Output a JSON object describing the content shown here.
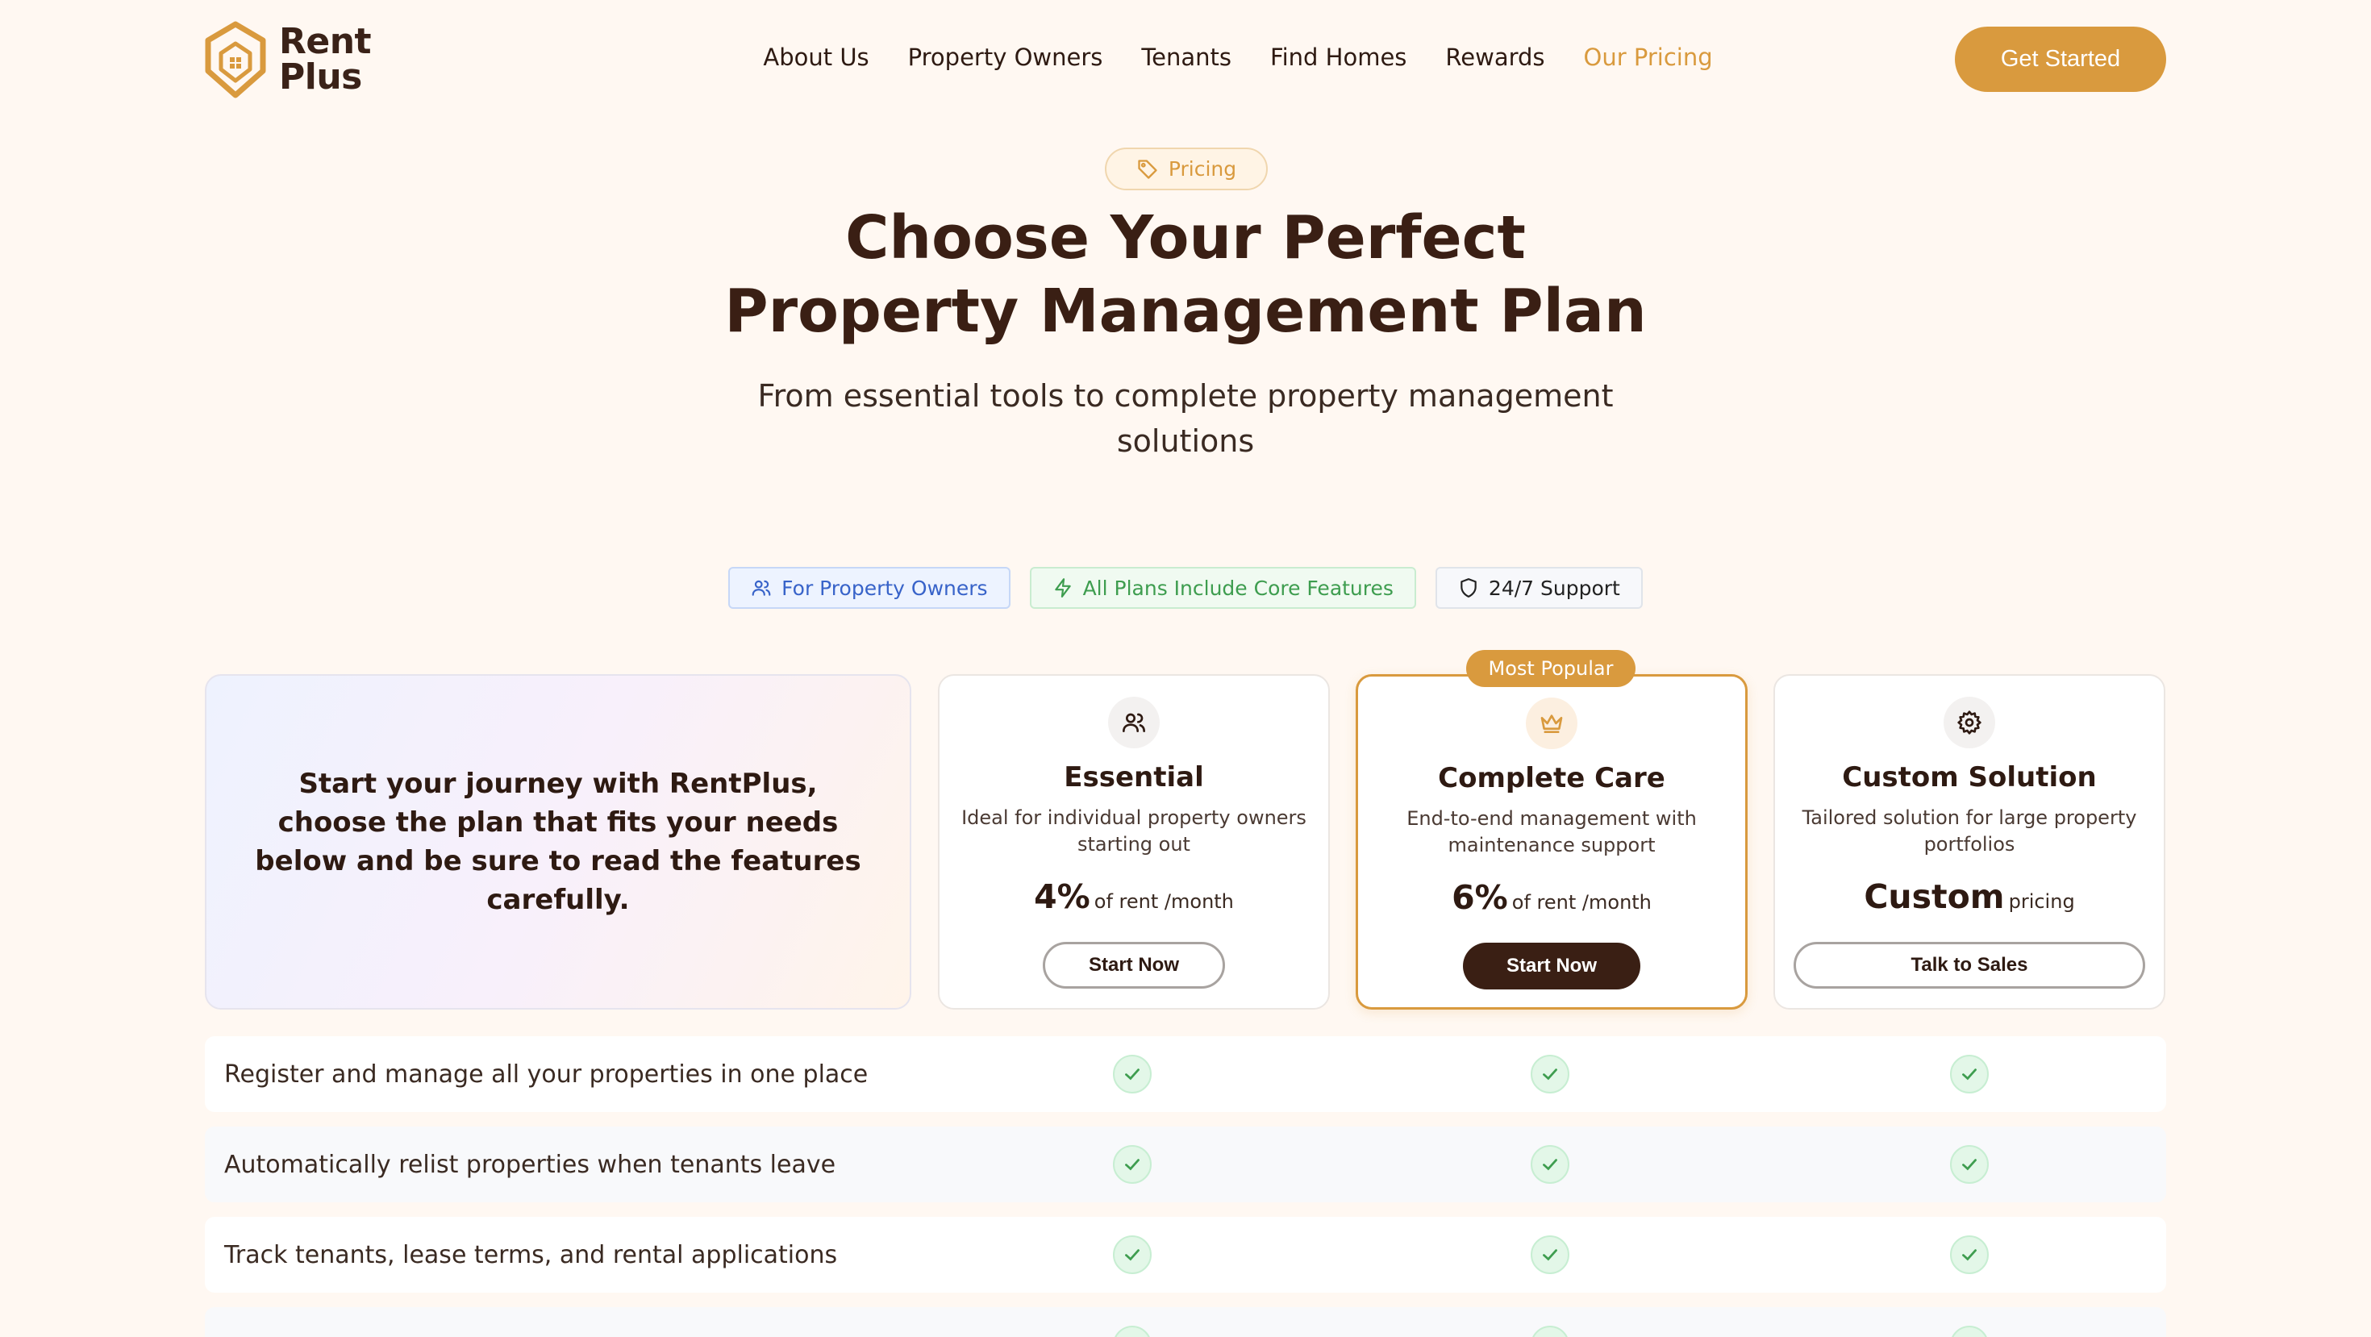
{
  "brand": {
    "line1": "Rent",
    "line2": "Plus",
    "accent": "#d99a3e"
  },
  "nav": {
    "links": [
      "About Us",
      "Property Owners",
      "Tenants",
      "Find Homes",
      "Rewards",
      "Our Pricing"
    ],
    "active_index": 5,
    "cta": "Get Started"
  },
  "hero": {
    "pill": "Pricing",
    "title_line1": "Choose Your Perfect",
    "title_line2": "Property Management Plan",
    "subtitle": "From essential tools to complete property management solutions"
  },
  "badges": [
    {
      "label": "For Property Owners",
      "icon": "users-icon",
      "style": "blue"
    },
    {
      "label": "All Plans Include Core Features",
      "icon": "lightning-icon",
      "style": "green"
    },
    {
      "label": "24/7 Support",
      "icon": "shield-icon",
      "style": "gray"
    }
  ],
  "intro": "Start your journey with RentPlus, choose the plan that fits your needs below and be sure to read the features carefully.",
  "popular_label": "Most Popular",
  "plans": [
    {
      "name": "Essential",
      "icon": "users-icon",
      "description": "Ideal for individual property owners starting out",
      "price": "4%",
      "unit": "of rent /month",
      "button": "Start Now",
      "button_style": "outline"
    },
    {
      "name": "Complete Care",
      "icon": "crown-icon",
      "description": "End-to-end management with maintenance support",
      "price": "6%",
      "unit": "of rent /month",
      "button": "Start Now",
      "button_style": "solid"
    },
    {
      "name": "Custom Solution",
      "icon": "gear-icon",
      "description": "Tailored solution for large property portfolios",
      "price": "Custom",
      "unit": "pricing",
      "button": "Talk to Sales",
      "button_style": "outline"
    }
  ],
  "features": [
    {
      "label": "Register and manage all your properties in one place",
      "essential": true,
      "complete": true,
      "custom": true
    },
    {
      "label": "Automatically relist properties when tenants leave",
      "essential": true,
      "complete": true,
      "custom": true
    },
    {
      "label": "Track tenants, lease terms, and rental applications",
      "essential": true,
      "complete": true,
      "custom": true
    },
    {
      "label": "",
      "essential": true,
      "complete": true,
      "custom": true
    }
  ]
}
